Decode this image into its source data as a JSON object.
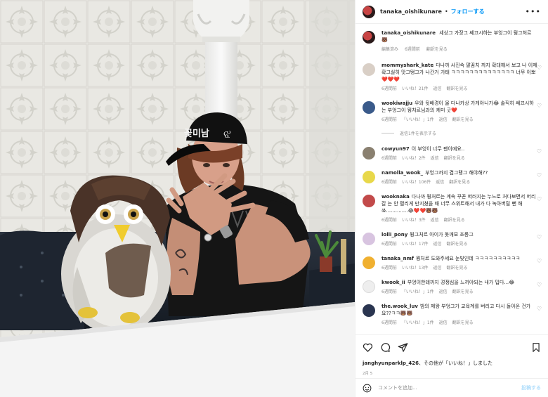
{
  "post": {
    "username": "tanaka_oishikunare",
    "follow_label": "フォローする",
    "separator": "•",
    "more_label": "•••"
  },
  "photo": {
    "cap_text": "꽃미남",
    "cap_emblem": "ଝ"
  },
  "caption": {
    "username": "tanaka_oishikunare",
    "text": "세상그 가장그 쎄끄시하는 부엉그이 뭥그처르 🐻",
    "meta": [
      "編集済み",
      "6週間前",
      "翻訳を見る"
    ]
  },
  "comments": [
    {
      "username": "mommyshark_kate",
      "text": "다나까 사진속 팔꿈치 까지 확대해서 보고 나 이제 확그실히 맛그탱그가 나간거 가태 ㅋㅋㅋㅋㅋㅋㅋㅋㅋㅋㅋㅋㅋㅋ 너무 이뽀❤️❤️❤️",
      "time": "6週間前",
      "likes": "いいね！21件",
      "reply": "返信",
      "translate": "翻訳を見る",
      "avatar_color": "#d9cfc6"
    },
    {
      "username": "wookiwajju",
      "text": "우와 뒷배경이 올 다나카상 가게아니가😂 솔직히 쎄끄시하는 부엉그이 뭥처르님과의 케미 굿❤️",
      "time": "6週間前",
      "likes": "「いいね！」1件",
      "reply": "返信",
      "translate": "翻訳を見る",
      "avatar_color": "#3a5a8a",
      "replies_label": "返信1件を表示する"
    },
    {
      "username": "cowyun97",
      "text": "이 부엉이 너무 팬이에요..",
      "time": "6週間前",
      "likes": "いいね！2件",
      "reply": "返信",
      "translate": "翻訳を見る",
      "avatar_color": "#8a8070"
    },
    {
      "username": "namolla_wook_",
      "text": "부엉그까지 겸그탱그 해야해??",
      "time": "6週間前",
      "likes": "いいね！106件",
      "reply": "返信",
      "translate": "翻訳を見る",
      "avatar_color": "#e8d84a"
    },
    {
      "username": "wooknaka",
      "text": "다나까 뭥처르는 계속 꾸끈 떠러지는 누느로 처다보면서 머리칼 는 안 펼리게 만지쳤을 때 너무 스위트해서 내가 다 녹아버릴 뻔 해쑈..............😂❤️❤️🐻🐻",
      "time": "6週間前",
      "likes": "いいね！3件",
      "reply": "返信",
      "translate": "翻訳を見る",
      "avatar_color": "#c24a4a"
    },
    {
      "username": "lolli_pony",
      "text": "뭥그처르 아이가 돗깨모 초롱그",
      "time": "6週間前",
      "likes": "いいね！17件",
      "reply": "返信",
      "translate": "翻訳を見る",
      "avatar_color": "#d8c4e0"
    },
    {
      "username": "tanaka_nmf",
      "text": "뭥처르 도와주세요 눈빛인데 ㅋㅋㅋㅋㅋㅋㅋㅋㅋㅋ",
      "time": "6週間前",
      "likes": "いいね！13件",
      "reply": "返信",
      "translate": "翻訳を見る",
      "avatar_color": "#f0b030"
    },
    {
      "username": "kwook_ii",
      "text": "부엉이한테까지 경쟁심을 느끼야되는 내가 밉다...😂",
      "time": "6週間前",
      "likes": "「いいね！」1件",
      "reply": "返信",
      "translate": "翻訳を見る",
      "avatar_color": "#eeeeee"
    },
    {
      "username": "the.wook_luv",
      "text": "밤의 제왕 부엉그가 교육계를 버리고 다시 돌아온 건가요??ㅋㅋ🐻🐻",
      "time": "6週間前",
      "likes": "「いいね！」1件",
      "reply": "返信",
      "translate": "翻訳を見る",
      "avatar_color": "#2a3550"
    }
  ],
  "actions": {
    "likes_user": "janghyunparklp_426",
    "likes_suffix": "、その他が「いいね！」しました",
    "date": "2月 5"
  },
  "add_comment": {
    "placeholder": "コメントを追加...",
    "post_label": "投稿する"
  }
}
